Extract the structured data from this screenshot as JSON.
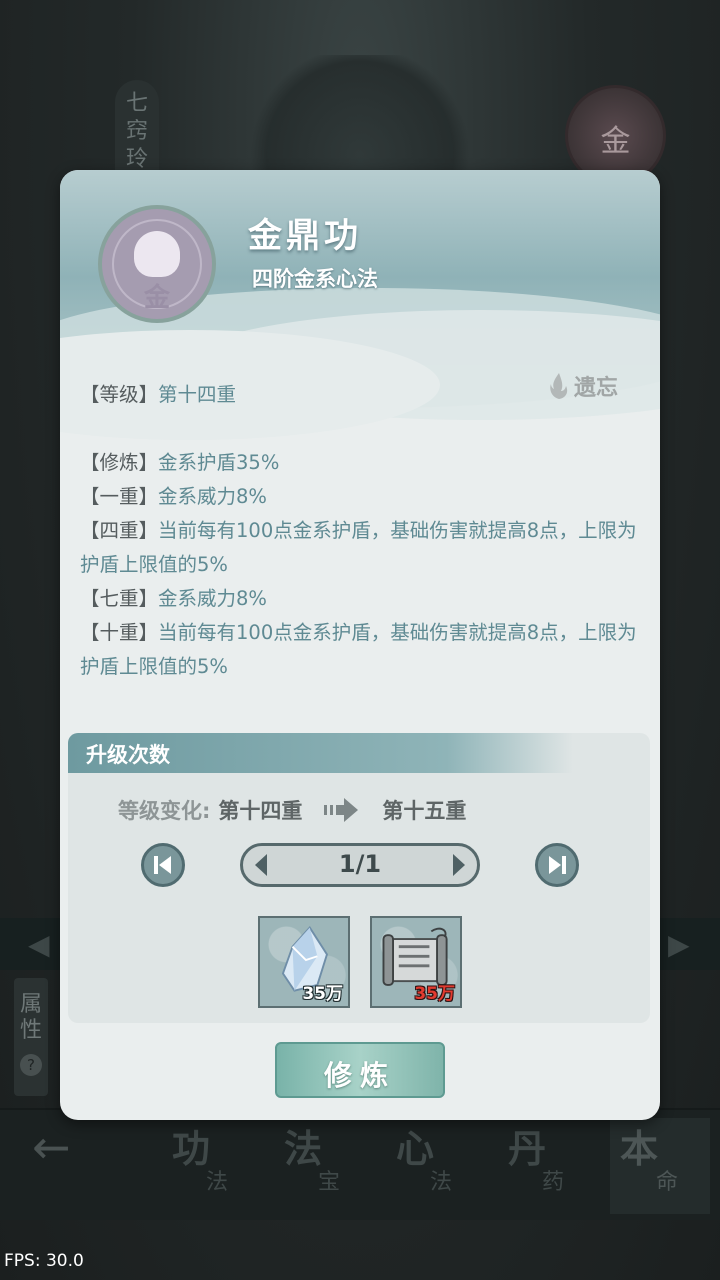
{
  "background": {
    "side_tab": "七窍玲",
    "avatar_char": "金",
    "attr_tab": "属性",
    "help": "?",
    "nav": [
      {
        "big": "功",
        "small": "法"
      },
      {
        "big": "法",
        "small": "宝"
      },
      {
        "big": "心",
        "small": "法"
      },
      {
        "big": "丹",
        "small": "药"
      },
      {
        "big": "本",
        "small": "命"
      }
    ]
  },
  "dialog": {
    "title": "金鼎功",
    "subtitle": "四阶金系心法",
    "avatar_char": "金",
    "forget_label": "遗忘",
    "desc": {
      "level_tag": "【等级】",
      "level_value": "第十四重",
      "lines": [
        {
          "tag": "【修炼】",
          "text": "金系护盾35%"
        },
        {
          "tag": "【一重】",
          "text": "金系威力8%"
        },
        {
          "tag": "【四重】",
          "text": "当前每有100点金系护盾，基础伤害就提高8点，上限为护盾上限值的5%"
        },
        {
          "tag": "【七重】",
          "text": "金系威力8%"
        },
        {
          "tag": "【十重】",
          "text": "当前每有100点金系护盾，基础伤害就提高8点，上限为护盾上限值的5%"
        }
      ]
    },
    "upgrade": {
      "title": "升级次数",
      "level_label": "等级变化:",
      "level_from": "第十四重",
      "level_to": "第十五重",
      "pager": "1/1",
      "items": [
        {
          "icon": "ice-crystal-icon",
          "count": "35万",
          "insufficient": false
        },
        {
          "icon": "scroll-icon",
          "count": "35万",
          "insufficient": true
        }
      ]
    },
    "cultivate_label": "修炼"
  },
  "fps": "FPS: 30.0",
  "colors": {
    "accent": "#6e9aa0",
    "desc_text": "#5f8a93",
    "insufficient": "#e23b30"
  }
}
